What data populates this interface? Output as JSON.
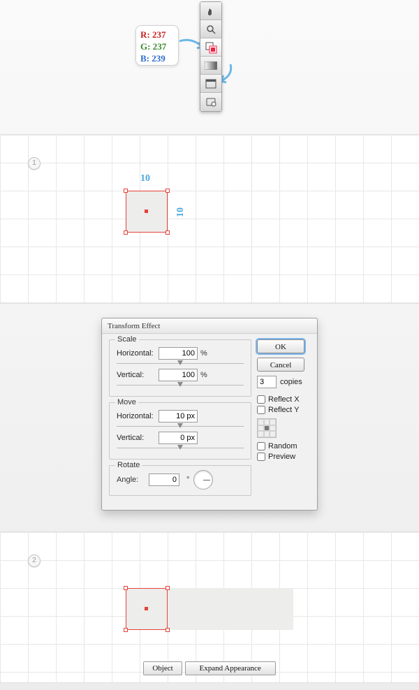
{
  "rgb": {
    "r": "R: 237",
    "g": "G: 237",
    "b": "B: 239"
  },
  "toolbar": {
    "items": [
      "hand-tool-icon",
      "zoom-tool-icon",
      "fill-stroke-swap-icon",
      "gradient-icon",
      "screen-mode-icon",
      "perspective-icon"
    ]
  },
  "step1": {
    "num": "1",
    "dimW": "10",
    "dimH": "10"
  },
  "dialog": {
    "title": "Transform Effect",
    "scale": {
      "legend": "Scale",
      "h_label": "Horizontal:",
      "h_value": "100",
      "v_label": "Vertical:",
      "v_value": "100",
      "unit": "%"
    },
    "move": {
      "legend": "Move",
      "h_label": "Horizontal:",
      "h_value": "10 px",
      "v_label": "Vertical:",
      "v_value": "0 px"
    },
    "rotate": {
      "legend": "Rotate",
      "angle_label": "Angle:",
      "angle_value": "0",
      "unit": "°"
    },
    "ok": "OK",
    "cancel": "Cancel",
    "copies_value": "3",
    "copies_label": "copies",
    "reflectX": "Reflect X",
    "reflectY": "Reflect Y",
    "random": "Random",
    "preview": "Preview"
  },
  "step2": {
    "num": "2"
  },
  "menu": {
    "object": "Object",
    "expand": "Expand Appearance"
  }
}
